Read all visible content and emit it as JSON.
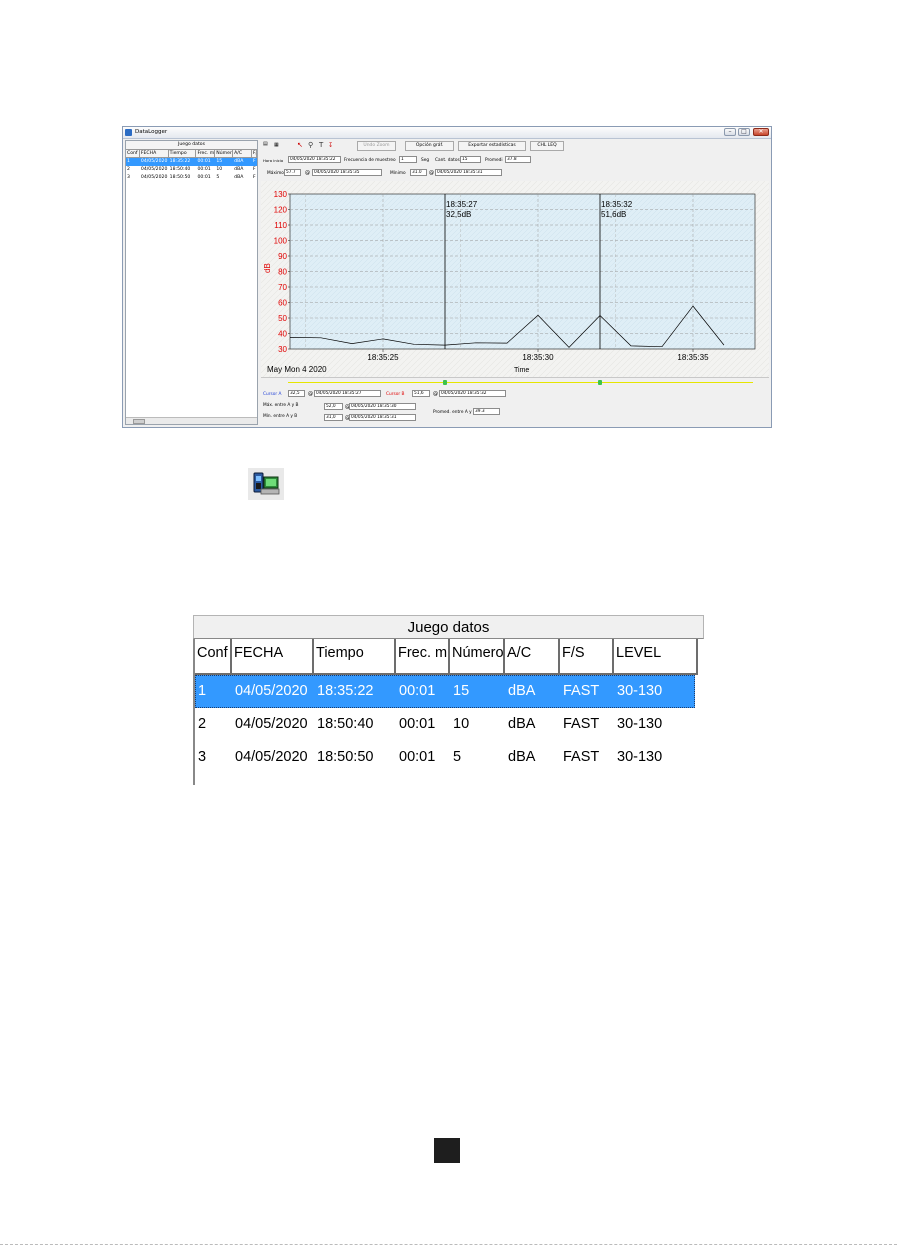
{
  "window": {
    "title": "DataLogger",
    "minimize_label": "–",
    "maximize_label": "□",
    "close_label": "✕"
  },
  "left_table": {
    "title": "Juego datos",
    "columns": [
      "Conf",
      "FECHA",
      "Tiempo",
      "Frec. m",
      "Número",
      "A/C",
      "F/S"
    ],
    "rows": [
      [
        "1",
        "04/05/2020",
        "18:35:22",
        "00:01",
        "15",
        "dBA",
        "F"
      ],
      [
        "2",
        "04/05/2020",
        "18:50:40",
        "00:01",
        "10",
        "dBA",
        "F"
      ],
      [
        "3",
        "04/05/2020",
        "18:50:50",
        "00:01",
        "5",
        "dBA",
        "F"
      ]
    ],
    "selected_row": 0
  },
  "toolbar": {
    "undo_zoom": "Undo Zoom",
    "chart_option": "Opción gráf.",
    "export_stats": "Exportar estadísticas",
    "leq": "CHL LEQ"
  },
  "info": {
    "start_label": "Hora inicio",
    "start_value": "04/05/2020 18:35:22",
    "freq_label": "Frecuencia de muestreo",
    "freq_value": "1",
    "freq_unit": "Seg",
    "count_label": "Cant. datos",
    "count_value": "15",
    "avg_label": "Promedi",
    "avg_value": "37.8",
    "max_label": "Máximo",
    "max_value": "57.7",
    "max_time": "04/05/2020 18:35:35",
    "min_label": "Mínimo",
    "min_value": "31.0",
    "min_time": "04/05/2020 18:35:31",
    "at_symbol": "@"
  },
  "chart_data": {
    "type": "line",
    "ylabel": "dB",
    "xlabel": "Time",
    "date_label": "May Mon 4 2020",
    "ylim": [
      30,
      130
    ],
    "yticks": [
      "130",
      "120",
      "110",
      "100",
      "90",
      "80",
      "70",
      "60",
      "50",
      "40",
      "30"
    ],
    "xticks": [
      {
        "t": 3,
        "label": "18:35:25"
      },
      {
        "t": 8,
        "label": "18:35:30"
      },
      {
        "t": 13,
        "label": "18:35:35"
      }
    ],
    "x": [
      0,
      1,
      2,
      3,
      4,
      5,
      6,
      7,
      8,
      9,
      10,
      11,
      12,
      13,
      14
    ],
    "values": [
      37.5,
      37.2,
      33.5,
      36.5,
      33.0,
      32.5,
      34.0,
      33.8,
      51.8,
      31.0,
      51.6,
      32.0,
      31.5,
      57.7,
      32.5
    ],
    "cursors": [
      {
        "t": 5,
        "time": "18:35:27",
        "value": "32,5dB"
      },
      {
        "t": 10,
        "time": "18:35:32",
        "value": "51,6dB"
      }
    ],
    "grid": true,
    "line_color": "#000000",
    "axis_label_color": "#e00000"
  },
  "cursor_panel": {
    "a_label": "Cursor A",
    "a_value": "32,5",
    "a_time": "04/05/2020 18:35:27",
    "b_label": "Cursor B",
    "b_value": "51,6",
    "b_time": "04/05/2020 18:35:32",
    "max_ab_label": "Máx. entre A y B",
    "max_ab_value": "52,0",
    "max_ab_time": "04/05/2020 18:35:30",
    "min_ab_label": "Mín. entre A y B",
    "min_ab_value": "31,0",
    "min_ab_time": "04/05/2020 18:35:31",
    "avg_ab_label": "Promed. entre A y B",
    "avg_ab_value": "39.3",
    "at_symbol": "@",
    "cursor_a_color": "#1f3fd6",
    "cursor_b_color": "#e00000"
  },
  "zoom_table": {
    "title": "Juego datos",
    "columns": [
      "Conf",
      "FECHA",
      "Tiempo",
      "Frec. mu",
      "Número",
      "A/C",
      "F/S",
      "LEVEL"
    ],
    "rows": [
      [
        "1",
        "04/05/2020",
        "18:35:22",
        "00:01",
        "15",
        "dBA",
        "FAST",
        "30-130"
      ],
      [
        "2",
        "04/05/2020",
        "18:50:40",
        "00:01",
        "10",
        "dBA",
        "FAST",
        "30-130"
      ],
      [
        "3",
        "04/05/2020",
        "18:50:50",
        "00:01",
        "5",
        "dBA",
        "FAST",
        "30-130"
      ]
    ],
    "selected_row": 0,
    "selection_color": "#3399ff"
  }
}
